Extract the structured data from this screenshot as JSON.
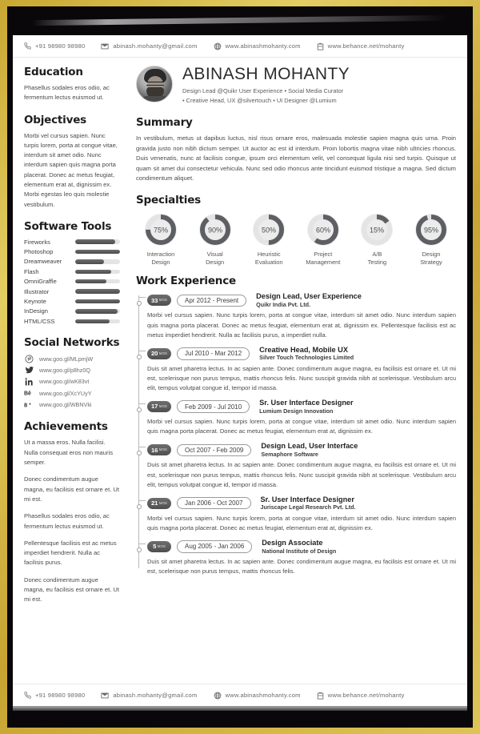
{
  "contact": {
    "phone": "+91 98980 98980",
    "email": "abinash.mohanty@gmail.com",
    "website": "www.abinashmohanty.com",
    "portfolio": "www.behance.net/mohanty"
  },
  "profile": {
    "name": "ABINASH MOHANTY",
    "tagline_line1": "Design Lead @Quikr User Experience • Social Media Curator",
    "tagline_line2": "• Creative Head, UX @silvertouch • UI Designer @Lumium"
  },
  "sidebar": {
    "education": {
      "heading": "Education",
      "text": "Phasellus sodales eros odio, ac fermentum lectus euismod ut."
    },
    "objectives": {
      "heading": "Objectives",
      "text": "Morbi vel cursus sapien. Nunc turpis lorem, porta at congue vitae, interdum sit amet odio. Nunc interdum sapien quis magna porta placerat. Donec ac metus feugiat, elementum erat at, dignissim ex. Morbi egestas leo quis molestie vestibulum."
    },
    "software_tools": {
      "heading": "Software Tools",
      "items": [
        {
          "name": "Fireworks",
          "level": 90
        },
        {
          "name": "Photoshop",
          "level": 100
        },
        {
          "name": "Dreamweaver",
          "level": 64
        },
        {
          "name": "Flash",
          "level": 80
        },
        {
          "name": "OmniGraffle",
          "level": 70
        },
        {
          "name": "Illustrator",
          "level": 100
        },
        {
          "name": "Keynote",
          "level": 100
        },
        {
          "name": "InDesign",
          "level": 94
        },
        {
          "name": "HTML/CSS",
          "level": 76
        }
      ]
    },
    "social_networks": {
      "heading": "Social Networks",
      "items": [
        {
          "icon": "pinterest-icon",
          "url": "www.goo.gl/MLpmjW"
        },
        {
          "icon": "twitter-icon",
          "url": "www.goo.gl/p8hz0Q"
        },
        {
          "icon": "linkedin-icon",
          "url": "www.goo.gl/wK83vt"
        },
        {
          "icon": "behance-icon",
          "url": "www.goo.gl/XcYUyY"
        },
        {
          "icon": "googleplus-icon",
          "url": "www.goo.gl/WBNVki"
        }
      ]
    },
    "achievements": {
      "heading": "Achievements",
      "paragraphs": [
        "Ut a massa eros. Nulla facilisi. Nulla consequat eros non mauris semper.",
        "Donec condimentum augue magna, eu facilisis est ornare et. Ut mi est.",
        "Phasellus sodales eros odio, ac fermentum lectus euismod ut.",
        "Pellentesque facilisis est ac metus imperdiet hendrerit. Nulla ac facilisis purus.",
        "Donec condimentum augue magna, eu facilisis est ornare et. Ut mi est."
      ]
    }
  },
  "main": {
    "summary": {
      "heading": "Summary",
      "text": "In vestibulum, metus ut dapibus luctus, nisl risus ornare eros, malesuada molestie sapien magna quis urna. Proin gravida justo non nibh dictum semper. Ut auctor ac est id interdum. Proin lobortis magna vitae nibh ultricies rhoncus. Duis venenatis, nunc at facilisis congue, ipsum orci elementum velit, vel consequat ligula nisi sed turpis. Quisque ut quam sit amet dui consectetur vehicula. Nunc sed odio rhoncus ante tincidunt euismod tristique a magna. Sed dictum condimentum aliquet."
    },
    "specialties": {
      "heading": "Specialties",
      "items": [
        {
          "label_line1": "Interaction",
          "label_line2": "Design",
          "percent": 75,
          "display": "75%"
        },
        {
          "label_line1": "Visual",
          "label_line2": "Design",
          "percent": 90,
          "display": "90%"
        },
        {
          "label_line1": "Heuristic",
          "label_line2": "Evaluation",
          "percent": 50,
          "display": "50%"
        },
        {
          "label_line1": "Project",
          "label_line2": "Management",
          "percent": 60,
          "display": "60%"
        },
        {
          "label_line1": "A/B",
          "label_line2": "Testing",
          "percent": 15,
          "display": "15%"
        },
        {
          "label_line1": "Design",
          "label_line2": "Strategy",
          "percent": 95,
          "display": "95%"
        }
      ]
    },
    "work_experience": {
      "heading": "Work Experience",
      "unit_label": "MOS",
      "jobs": [
        {
          "months": "33",
          "dates": "Apr 2012 - Present",
          "title": "Design Lead, User Experience",
          "org": "Quikr India Pvt. Ltd.",
          "desc": "Morbi vel cursus sapien. Nunc turpis lorem, porta at congue vitae, interdum sit amet odio. Nunc interdum sapien quis magna porta placerat. Donec ac metus feugiat, elementum erat at, dignissim ex. Pellentesque facilisis est ac metus imperdiet hendrerit. Nulla ac facilisis purus, a imperdiet nulla."
        },
        {
          "months": "20",
          "dates": "Jul 2010 - Mar 2012",
          "title": "Creative Head, Mobile UX",
          "org": "Silver Touch Technologies Limited",
          "desc": "Duis sit amet pharetra lectus. In ac sapien ante. Donec condimentum augue magna, eu facilisis est ornare et. Ut mi est, scelerisque non purus tempus, mattis rhoncus felis. Nunc suscipit gravida nibh at scelerisque. Vestibulum arcu elit, tempus volutpat congue id, tempor id massa."
        },
        {
          "months": "17",
          "dates": "Feb 2009 - Jul 2010",
          "title": "Sr. User Interface Designer",
          "org": "Lumium Design Innovation",
          "desc": "Morbi vel cursus sapien. Nunc turpis lorem, porta at congue vitae, interdum sit amet odio. Nunc interdum sapien quis magna porta placerat. Donec ac metus feugiat, elementum erat at, dignissim ex."
        },
        {
          "months": "16",
          "dates": "Oct 2007 - Feb 2009",
          "title": "Design Lead, User Interface",
          "org": "Semaphore Software",
          "desc": "Duis sit amet pharetra lectus. In ac sapien ante. Donec condimentum augue magna, eu facilisis est ornare et. Ut mi est, scelerisque non purus tempus, mattis rhoncus felis. Nunc suscipit gravida nibh at scelerisque. Vestibulum arcu elit, tempus volutpat congue id, tempor id massa."
        },
        {
          "months": "21",
          "dates": "Jan 2006 - Oct 2007",
          "title": "Sr. User Interface Designer",
          "org": "Juriscape Legal Research Pvt. Ltd.",
          "desc": "Morbi vel cursus sapien. Nunc turpis lorem, porta at congue vitae, interdum sit amet odio. Nunc interdum sapien quis magna porta placerat. Donec ac metus feugiat, elementum erat at, dignissim ex."
        },
        {
          "months": "5",
          "dates": "Aug 2005 - Jan 2006",
          "title": "Design Associate",
          "org": "National Institute of Design",
          "desc": "Duis sit amet pharetra lectus. In ac sapien ante. Donec condimentum augue magna, eu facilisis est ornare et. Ut mi est, scelerisque non purus tempus, mattis rhoncus felis."
        }
      ]
    }
  },
  "theme": {
    "frame_gold": "#c9a732",
    "frame_dark": "#09070a",
    "paper": "#ffffff",
    "ink": "#1d1d1d",
    "muted": "#6b6b6b",
    "bar_fill": "#4f4f4f",
    "bar_track": "#e4e4e4"
  }
}
